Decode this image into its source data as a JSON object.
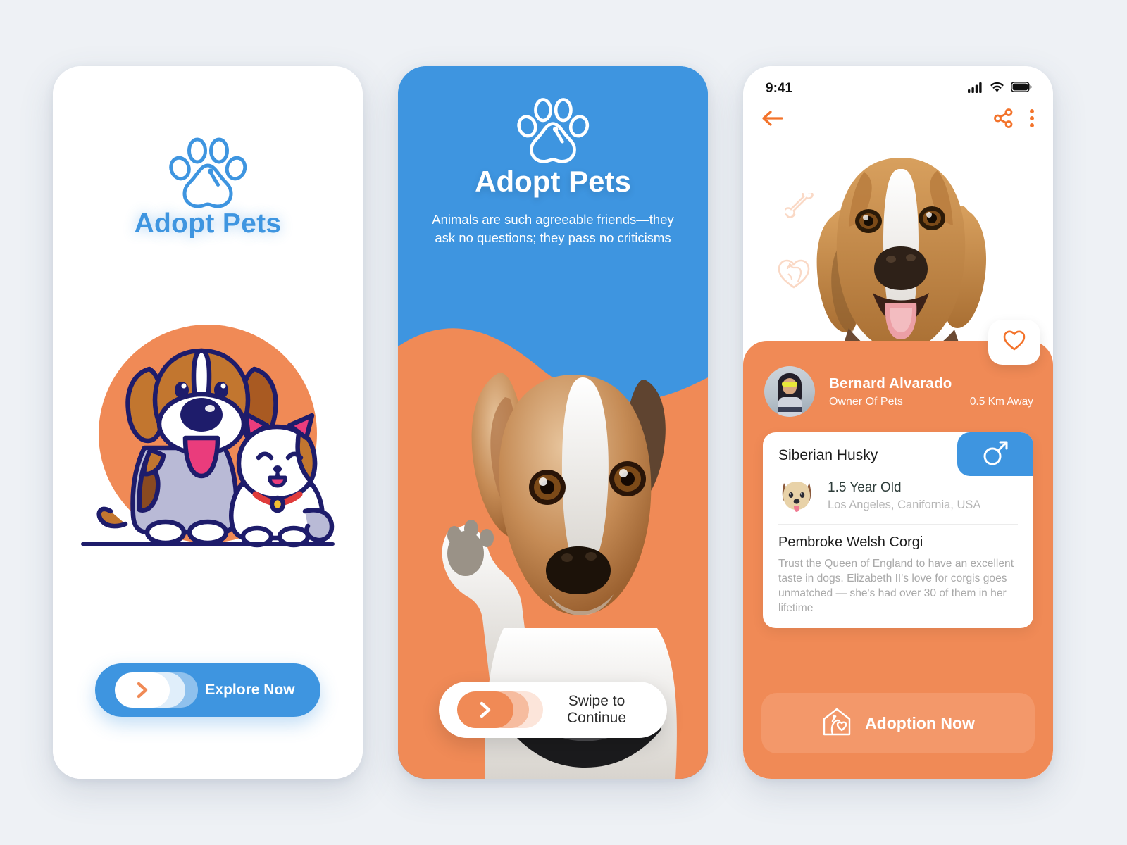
{
  "theme": {
    "orange": "#F08A56",
    "blue": "#3E95E0",
    "page_background": "#EEF1F5",
    "card_white": "#FFFFFF"
  },
  "screen1": {
    "logo_icon": "paw-print-icon",
    "title": "Adopt Pets",
    "illustration": "dog-and-cat-illustration",
    "cta": {
      "label": "Explore Now",
      "slider_icon": "chevron-right-icon"
    }
  },
  "screen2": {
    "logo_icon": "paw-print-icon",
    "title": "Adopt Pets",
    "subtitle": "Animals are such agreeable friends—they ask no questions; they pass no criticisms",
    "photo": "jack-russell-terrier-photo",
    "cta": {
      "label": "Swipe to Continue",
      "slider_icon": "chevron-right-icon"
    }
  },
  "screen3": {
    "status_bar": {
      "time": "9:41",
      "icons": [
        "cellular-signal-icon",
        "wifi-icon",
        "battery-icon"
      ]
    },
    "nav": {
      "back_icon": "arrow-left-icon",
      "share_icon": "share-icon",
      "more_icon": "more-vertical-icon"
    },
    "hero": {
      "photo": "beagle-dog-photo",
      "decor_icons": [
        "bone-icon",
        "dog-in-heart-icon"
      ],
      "favorite_icon": "heart-outline-icon"
    },
    "owner": {
      "avatar": "owner-avatar-photo",
      "name": "Bernard Alvarado",
      "role": "Owner Of Pets",
      "distance": "0.5 Km Away"
    },
    "pet_card": {
      "breed_title": "Siberian Husky",
      "gender_icon": "male-symbol-icon",
      "pet_icon": "dog-face-icon",
      "age": "1.5 Year Old",
      "location": "Los Angeles, Canifornia, USA",
      "secondary_breed": "Pembroke Welsh Corgi",
      "description": "Trust the Queen of England to have an excellent taste in dogs. Elizabeth II's love for corgis goes unmatched — she's had over 30 of them in her lifetime"
    },
    "adopt_button": {
      "label": "Adoption Now",
      "icon": "pet-house-icon"
    }
  }
}
